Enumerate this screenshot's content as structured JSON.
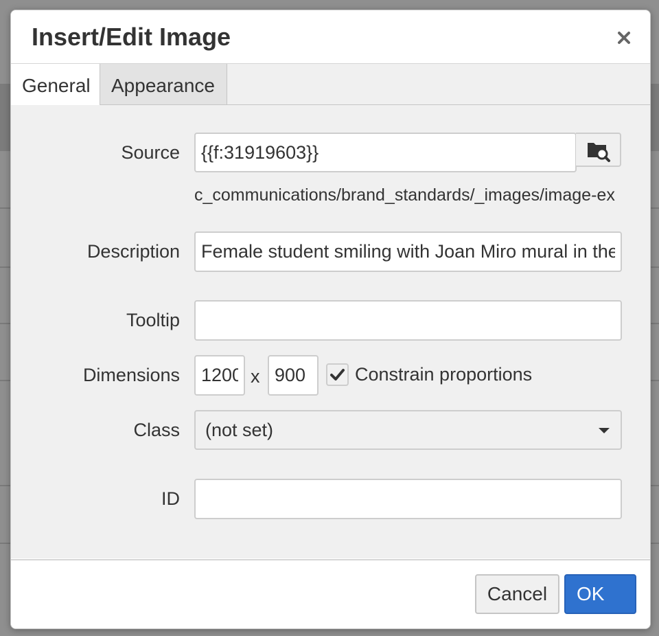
{
  "dialog": {
    "title": "Insert/Edit Image",
    "close_icon": "close-icon"
  },
  "tabs": [
    {
      "label": "General",
      "active": true
    },
    {
      "label": "Appearance",
      "active": false
    }
  ],
  "form": {
    "source": {
      "label": "Source",
      "value": "{{f:31919603}}",
      "browse_icon": "browse-folder-search-icon"
    },
    "path_text": "c_communications/brand_standards/_images/image-ex",
    "description": {
      "label": "Description",
      "value": "Female student smiling with Joan Miro mural in the background"
    },
    "tooltip": {
      "label": "Tooltip",
      "value": ""
    },
    "dimensions": {
      "label": "Dimensions",
      "width": "1200",
      "height": "900",
      "separator": "x"
    },
    "constrain": {
      "label": "Constrain proportions",
      "checked": true
    },
    "class": {
      "label": "Class",
      "selected": "(not set)"
    },
    "id": {
      "label": "ID",
      "value": ""
    }
  },
  "footer": {
    "cancel_label": "Cancel",
    "ok_label": "OK"
  },
  "colors": {
    "primary": "#2f72cf",
    "panel": "#f0f0f0",
    "border": "#cdcdcd"
  }
}
